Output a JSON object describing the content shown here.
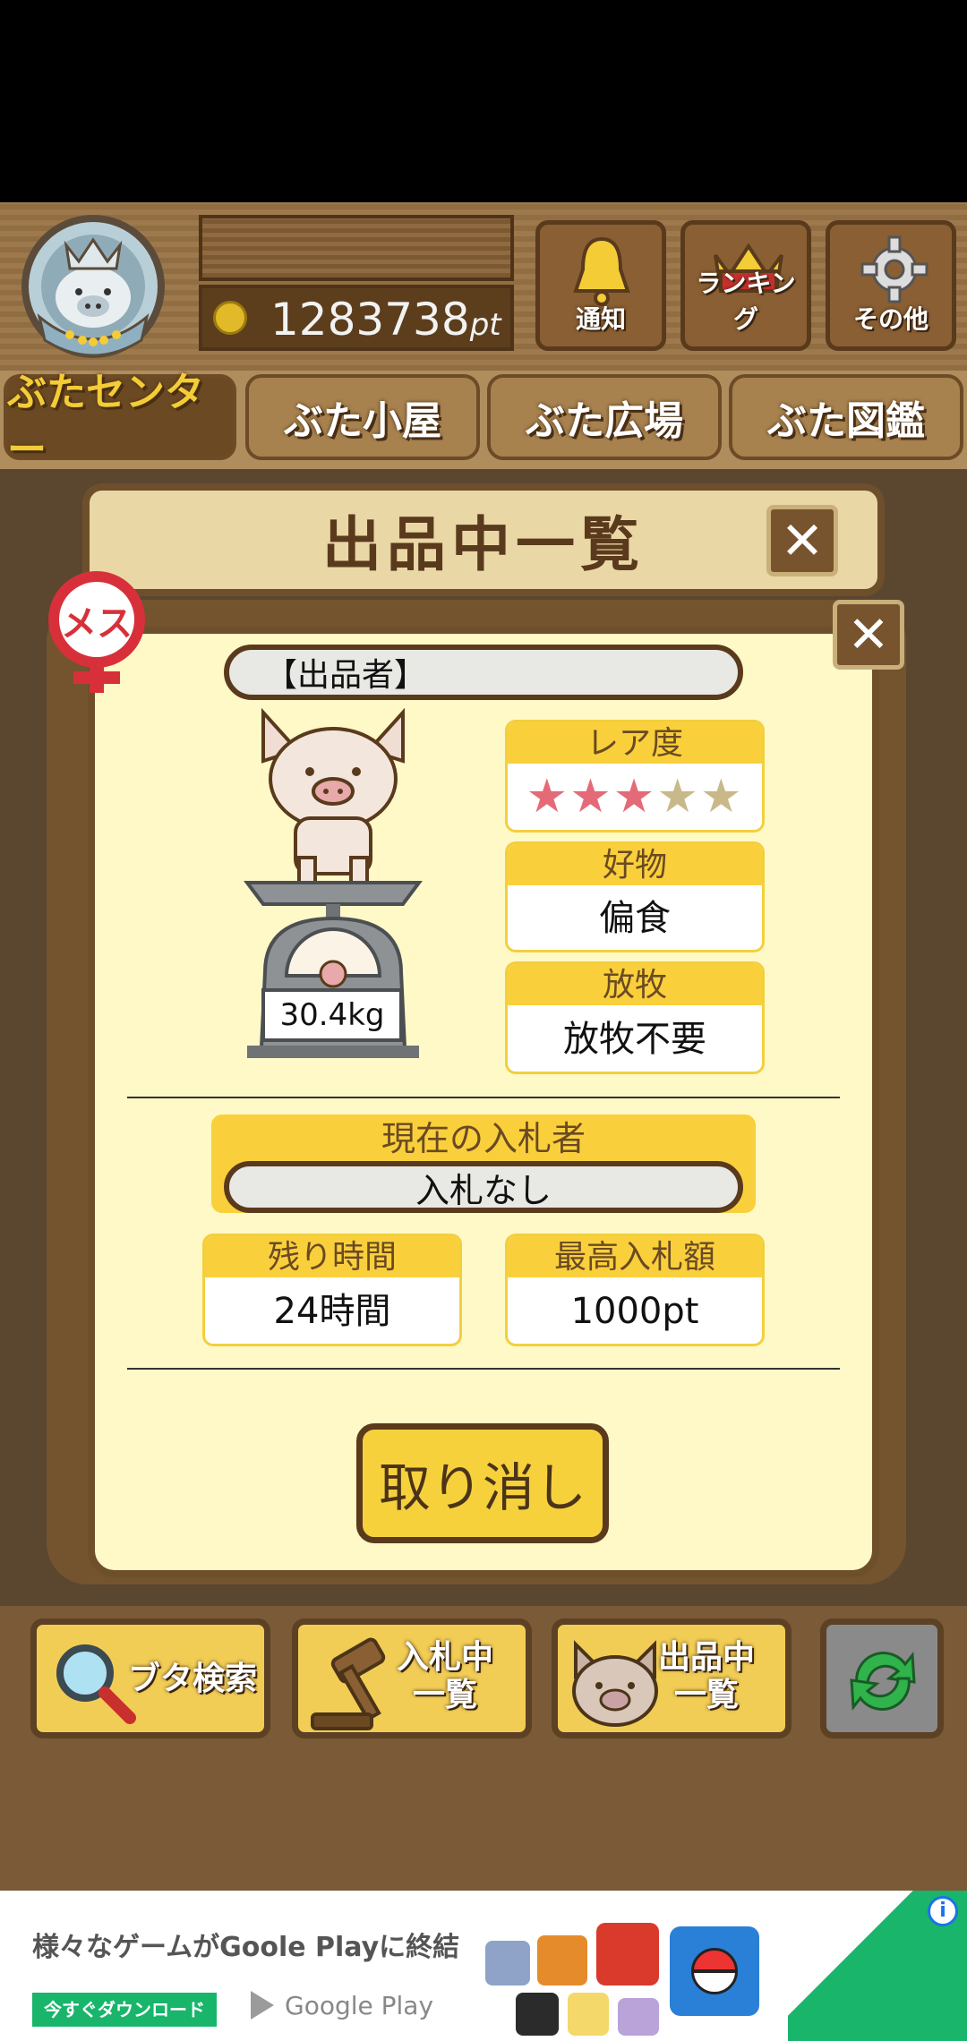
{
  "header": {
    "points": "1283738",
    "points_unit": "pt",
    "bell_label": "通知",
    "ranking_label": "ランキング",
    "other_label": "その他"
  },
  "tabs": [
    {
      "label": "ぶたセンター",
      "active": true
    },
    {
      "label": "ぶた小屋",
      "active": false
    },
    {
      "label": "ぶた広場",
      "active": false
    },
    {
      "label": "ぶた図鑑",
      "active": false
    }
  ],
  "modal": {
    "title": "出品中一覧",
    "gender_label": "メス",
    "seller_label": "【出品者】",
    "weight": "30.4kg",
    "rarity": {
      "label": "レア度",
      "stars_filled": 3,
      "stars_total": 5
    },
    "favorite": {
      "label": "好物",
      "value": "偏食"
    },
    "grazing": {
      "label": "放牧",
      "value": "放牧不要"
    },
    "current_bidder": {
      "label": "現在の入札者",
      "value": "入札なし"
    },
    "remaining_time": {
      "label": "残り時間",
      "value": "24時間"
    },
    "highest_bid": {
      "label": "最高入札額",
      "value": "1000pt"
    },
    "cancel_label": "取り消し"
  },
  "bottom_nav": {
    "search_label": "ブタ検索",
    "bidding_label_1": "入札中",
    "bidding_label_2": "一覧",
    "listing_label_1": "出品中",
    "listing_label_2": "一覧"
  },
  "ad": {
    "headline": "様々なゲームがGoole Playに終結",
    "cta": "今すぐダウンロード",
    "store": "Google Play"
  },
  "colors": {
    "accent_yellow": "#f9d03b",
    "wood_dark": "#5a3a1c",
    "cream": "#fff9c8",
    "female_red": "#d8303a",
    "star_filled": "#e56a78",
    "star_empty": "#c9b98a"
  }
}
